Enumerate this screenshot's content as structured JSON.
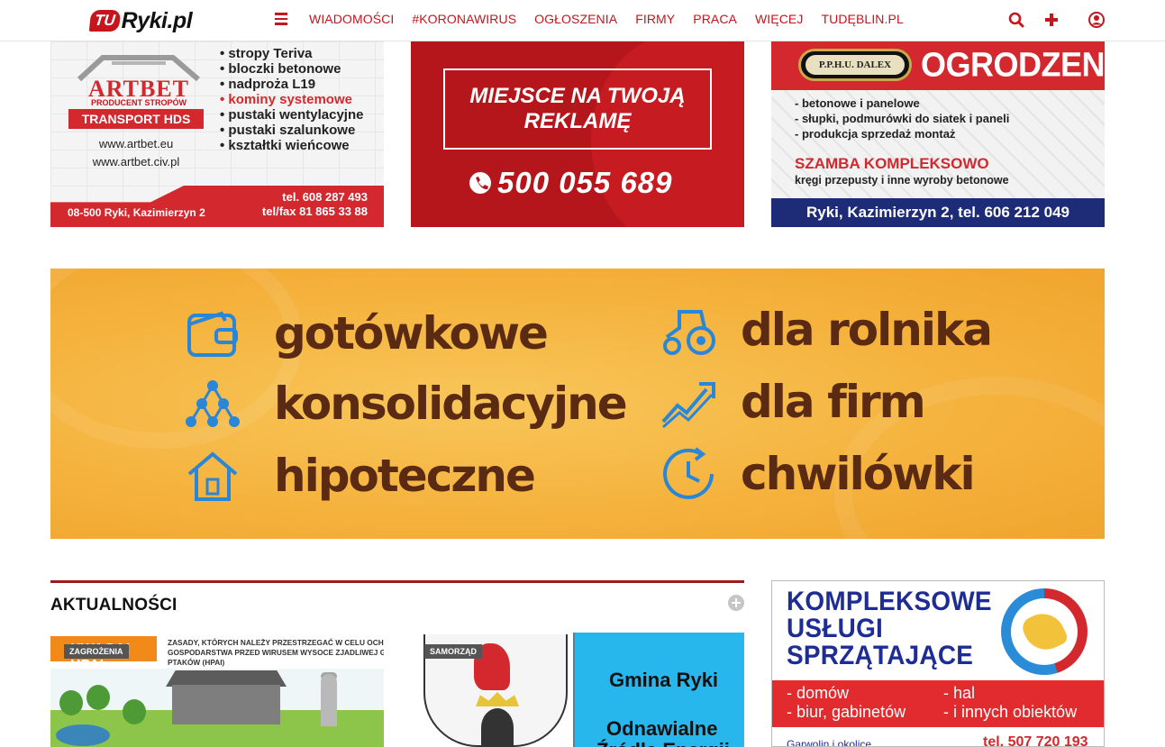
{
  "navbar": {
    "logo_tu": "TU",
    "logo_site": "Ryki.pl",
    "menu_icon": "bars-icon",
    "items": [
      {
        "label": "WIADOMOŚCI"
      },
      {
        "label": "#KORONAWIRUS"
      },
      {
        "label": "OGŁOSZENIA"
      },
      {
        "label": "FIRMY"
      },
      {
        "label": "PRACA"
      },
      {
        "label": "WIĘCEJ"
      },
      {
        "label": "TUDĘBLIN.PL"
      }
    ],
    "icons": [
      "search-icon",
      "plus-icon",
      "user-icon"
    ],
    "accent_color": "#c4161c"
  },
  "ads": {
    "artbet": {
      "name": "ARTBET",
      "subtitle": "PRODUCENT STROPÓW",
      "hds": "TRANSPORT HDS",
      "www1": "www.artbet.eu",
      "www2": "www.artbet.civ.pl",
      "list": [
        "• stropy Teriva",
        "• bloczki betonowe",
        "• nadproża L19",
        "• kominy systemowe",
        "• pustaki wentylacyjne",
        "• pustaki szalunkowe",
        "• kształtki wieńcowe"
      ],
      "address": "08-500 Ryki, Kazimierzyn 2",
      "tel1": "tel. 608 287 493",
      "tel2": "tel/fax 81 865 33 88"
    },
    "miejsce": {
      "line1": "MIEJSCE NA TWOJĄ",
      "line2": "REKLAMĘ",
      "phone": "500 055 689",
      "phone_icon": "phone-icon"
    },
    "dalex": {
      "logo": "P.P.H.U. DALEX",
      "title": "OGRODZENIA",
      "list": [
        "- betonowe i panelowe",
        "- słupki, podmurówki do siatek i paneli",
        "- produkcja sprzedaż montaż"
      ],
      "szamba": "SZAMBA KOMPLEKSOWO",
      "kregi": "kręgi przepusty i inne wyroby betonowe",
      "bottom": "Ryki, Kazimierzyn 2, tel. 606 212 049"
    },
    "loans": {
      "items": [
        {
          "label": "gotówkowe",
          "icon": "wallet-icon"
        },
        {
          "label": "konsolidacyjne",
          "icon": "network-icon"
        },
        {
          "label": "hipoteczne",
          "icon": "house-icon"
        },
        {
          "label": "dla rolnika",
          "icon": "tractor-icon"
        },
        {
          "label": "dla firm",
          "icon": "chart-growth-icon"
        },
        {
          "label": "chwilówki",
          "icon": "clock-icon"
        }
      ]
    },
    "cleaning": {
      "title_l1": "KOMPLEKSOWE",
      "title_l2": "USŁUGI",
      "title_l3": "SPRZĄTAJĄCE",
      "left": [
        "- domów",
        "- biur, gabinetów"
      ],
      "right": [
        "- hal",
        "- i innych obiektów"
      ],
      "foot_left": "Garwolin i okolice",
      "foot_right": "tel. 507 720 193"
    }
  },
  "news": {
    "title": "AKTUALNOŚCI",
    "more_icon": "plus-circle-icon",
    "cards": [
      {
        "badge": "ZAGROŻENIA",
        "header": "UWAGA! HPAI",
        "text_l1": "ZASADY, KTÓRYCH NALEŻY PRZESTRZEGAĆ W CELU OCHRONY",
        "text_l2": "GOSPODARSTWA PRZED WIRUSEM WYSOCE ZJADLIWEJ GRYPY",
        "text_l3": "PTAKÓW (HPAI)"
      },
      {
        "badge": "SAMORZĄD",
        "gmina": "Gmina Ryki",
        "odnawialne": "Odnawialne",
        "zrodla": "Źródła Energii"
      }
    ]
  }
}
